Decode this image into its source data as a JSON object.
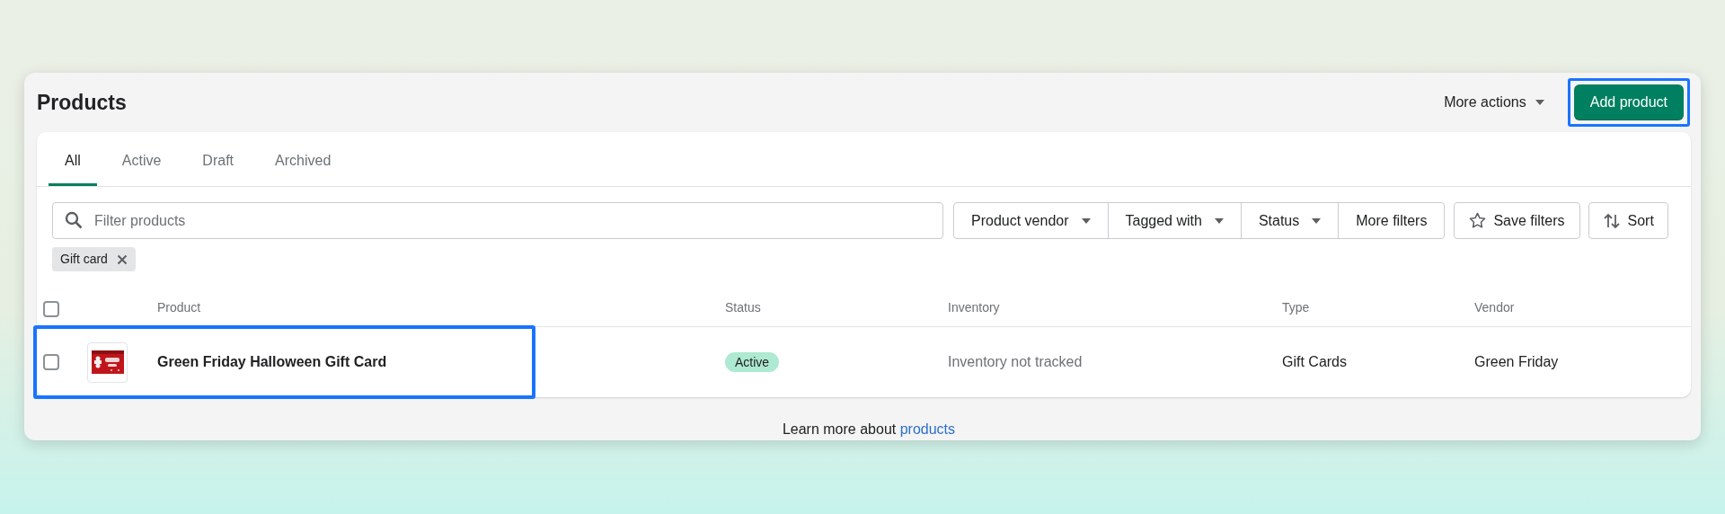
{
  "page": {
    "title": "Products"
  },
  "header_actions": {
    "more_actions": "More actions",
    "add_product": {
      "label": "Add product",
      "highlighted": true
    }
  },
  "tabs": [
    {
      "label": "All",
      "selected": true
    },
    {
      "label": "Active",
      "selected": false
    },
    {
      "label": "Draft",
      "selected": false
    },
    {
      "label": "Archived",
      "selected": false
    }
  ],
  "search": {
    "placeholder": "Filter products"
  },
  "filters": [
    {
      "label": "Product vendor",
      "kind": "dropdown"
    },
    {
      "label": "Tagged with",
      "kind": "dropdown"
    },
    {
      "label": "Status",
      "kind": "dropdown"
    },
    {
      "label": "More filters",
      "kind": "plain"
    }
  ],
  "save_filters": "Save filters",
  "sort": "Sort",
  "applied_filters": [
    {
      "label": "Gift card"
    }
  ],
  "table": {
    "columns": [
      "Product",
      "Status",
      "Inventory",
      "Type",
      "Vendor"
    ],
    "select_all_checked": false,
    "rows": [
      {
        "checked": false,
        "highlighted": true,
        "product": "Green Friday Halloween Gift Card",
        "status": "Active",
        "inventory": "Inventory not tracked",
        "type": "Gift Cards",
        "vendor": "Green Friday"
      }
    ]
  },
  "footer": {
    "text": "Learn more about",
    "link": "products"
  }
}
